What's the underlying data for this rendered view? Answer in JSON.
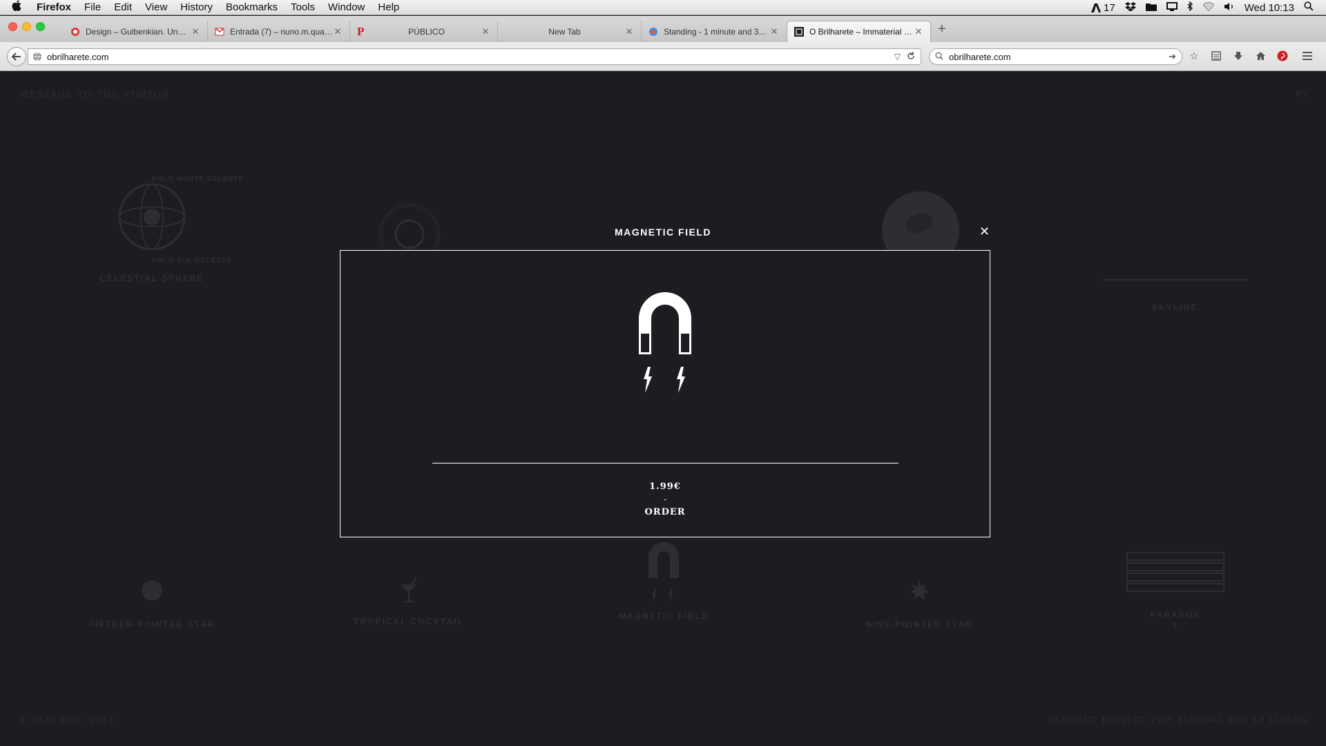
{
  "menubar": {
    "app_name": "Firefox",
    "menus": [
      "File",
      "Edit",
      "View",
      "History",
      "Bookmarks",
      "Tools",
      "Window",
      "Help"
    ],
    "status": {
      "badge_count": "17",
      "clock": "Wed 10:13"
    }
  },
  "tabs": [
    {
      "title": "Design – Gulbenkian. Unp…",
      "favicon": "gulbenkian-icon"
    },
    {
      "title": "Entrada (7) – nuno.m.qua…",
      "favicon": "gmail-icon"
    },
    {
      "title": "PÚBLICO",
      "favicon": "publico-icon"
    },
    {
      "title": "New Tab",
      "favicon": ""
    },
    {
      "title": "Standing - 1 minute and 3…",
      "favicon": "standing-icon"
    },
    {
      "title": "O Brilharete – Immaterial …",
      "favicon": "brilharete-icon",
      "active": true
    }
  ],
  "navbar": {
    "url": "obrilharete.com",
    "search_value": "obrilharete.com"
  },
  "page": {
    "message_link": "MESSAGE TO THE VISITOR",
    "lang_link": "PT",
    "footer_left": "© BEM BOM, 2013",
    "footer_right": "TANGENT PROJECT FOR BIENNAL EXD'13 LISBOA",
    "items": {
      "celestial_sphere": "CELESTIAL SPHERE",
      "celestial_north": "POLO NORTE CELESTE",
      "celestial_south": "POLO SUL CELESTE",
      "skyline": "SKYLINE",
      "fifteen_star": "FIFTEEN-POINTED STAR",
      "tropical_cocktail": "TROPICAL COCKTAIL",
      "magnetic_field": "MAGNETIC FIELD",
      "nine_star": "NINE-POINTED STAR",
      "paradox": "PARADOX",
      "paradox_q": "?"
    }
  },
  "modal": {
    "title": "MAGNETIC FIELD",
    "price": "1.99€",
    "separator": "-",
    "order_label": "ORDER"
  },
  "colors": {
    "page_bg": "#1d1d21",
    "modal_line": "#ffffff",
    "faint_text": "#2d2d33"
  }
}
